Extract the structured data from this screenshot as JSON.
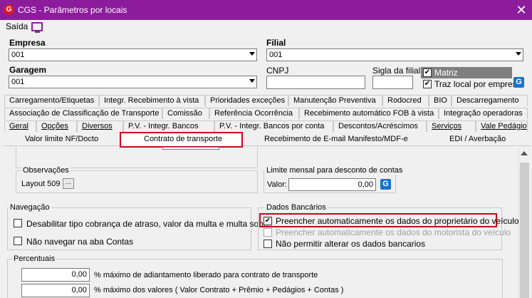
{
  "window": {
    "title": "CGS - Parâmetros por locais",
    "logo": "G",
    "close": "✕"
  },
  "menu": {
    "saida": "Saída",
    "icon": "monitor-icon"
  },
  "empresa": {
    "label": "Empresa",
    "value": "001"
  },
  "filial": {
    "label": "Filial",
    "value": "001"
  },
  "garagem": {
    "label": "Garagem",
    "value": "001"
  },
  "cnpj": {
    "label": "CNPJ",
    "value": ""
  },
  "sigla": {
    "label": "Sigla da filial",
    "value": ""
  },
  "matriz": {
    "label": "Matriz",
    "checked": "✔"
  },
  "traz_local": {
    "label": "Traz local por empresa",
    "checked": "✔"
  },
  "tabs": {
    "row1": [
      "Carregamento/Etiquetas",
      "Integr. Recebimento à vista",
      "Prioridades exceções",
      "Manutenção Preventiva",
      "Rodocred",
      "BIO",
      "Descarregamento"
    ],
    "row2": [
      "Associação de Classificação de Transporte",
      "Comissão",
      "Referência Ocorrência",
      "Recebimento automático FOB à vista",
      "Integração operadoras"
    ],
    "row3": [
      "Geral",
      "Opções",
      "Diversos",
      "P.V. - Integr. Bancos",
      "P.V. - Integr. Bancos por conta",
      "Descontos/Acréscimos",
      "Serviços",
      "Vale Pedágio"
    ]
  },
  "subtabs": [
    "Valor limite NF/Docto",
    "Contrato de transporte",
    "Recebimento de E-mail Manifesto/MDF-e",
    "EDI / Averbação"
  ],
  "observacoes": {
    "title": "Observações",
    "layout_label": "Layout 509",
    "button": "···"
  },
  "limite": {
    "title": "Limite mensal para desconto de contas",
    "valor_label": "Valor:",
    "valor": "0,00"
  },
  "navegacao": {
    "title": "Navegação",
    "items": [
      "Desabilitar tipo cobrança de atraso, valor da multa e multa sobre",
      "Não navegar na aba Contas"
    ]
  },
  "dados_bancarios": {
    "title": "Dados Bancários",
    "items": [
      "Preencher automaticamente os dados do proprietário do veículo",
      "Preencher automaticamente os dados do motorista do veículo",
      "Não permitir alterar os dados bancarios"
    ],
    "check_mark": "✔"
  },
  "percentuais": {
    "title": "Percentuais",
    "rows": [
      {
        "value": "0,00",
        "label": "% máximo de adiantamento liberado para contrato de transporte"
      },
      {
        "value": "0,00",
        "label": "% máximo dos valores ( Valor Contrato + Prêmio + Pedágios + Contas )"
      }
    ]
  },
  "colors": {
    "titlebar": "#8c1c9c",
    "highlight": "#d0021b",
    "accent_icon": "#1a73c8"
  }
}
